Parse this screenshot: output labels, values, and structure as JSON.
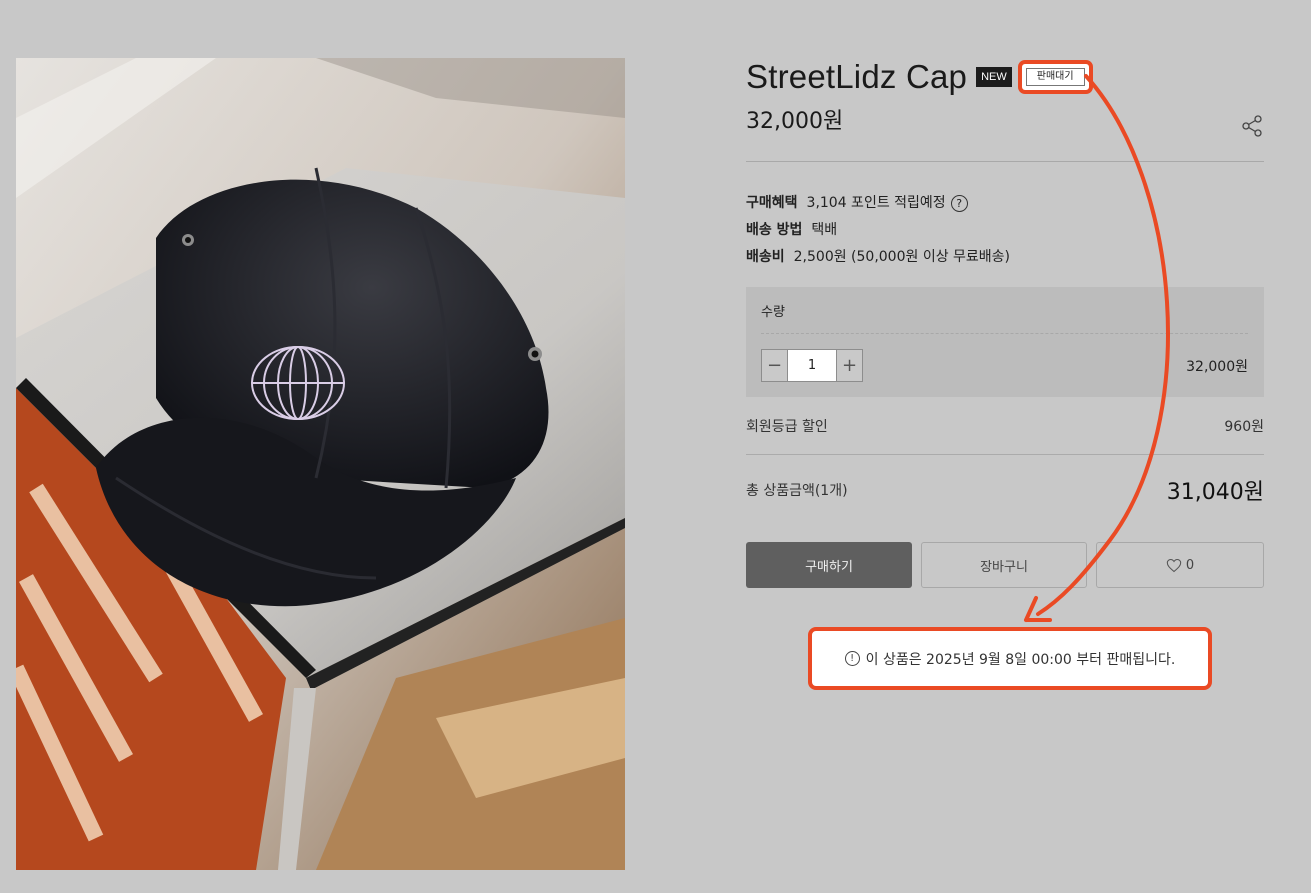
{
  "product": {
    "title": "StreetLidz Cap",
    "badge_new": "NEW",
    "badge_status": "판매대기",
    "price": "32,000원"
  },
  "icons": {
    "share": "share-icon",
    "help": "question-circle-icon",
    "minus": "minus-icon",
    "plus": "plus-icon",
    "heart": "heart-icon",
    "info": "info-circle-icon"
  },
  "meta": {
    "benefit_label": "구매혜택",
    "benefit_value": "3,104 포인트 적립예정",
    "shipping_label": "배송 방법",
    "shipping_value": "택배",
    "fee_label": "배송비",
    "fee_value": "2,500원 (50,000원 이상 무료배송)"
  },
  "quantity": {
    "label": "수량",
    "value": "1",
    "line_price": "32,000원"
  },
  "discount": {
    "label": "회원등급 할인",
    "value": "960원"
  },
  "total": {
    "label": "총 상품금액(1개)",
    "value": "31,040원"
  },
  "buttons": {
    "buy": "구매하기",
    "cart": "장바구니",
    "like_count": "0"
  },
  "notice": {
    "text": "이 상품은 2025년 9월 8일 00:00 부터 판매됩니다."
  },
  "colors": {
    "annotation": "#ea4a24",
    "buy_button": "#5f5f5f",
    "page_bg": "#c8c8c8"
  }
}
